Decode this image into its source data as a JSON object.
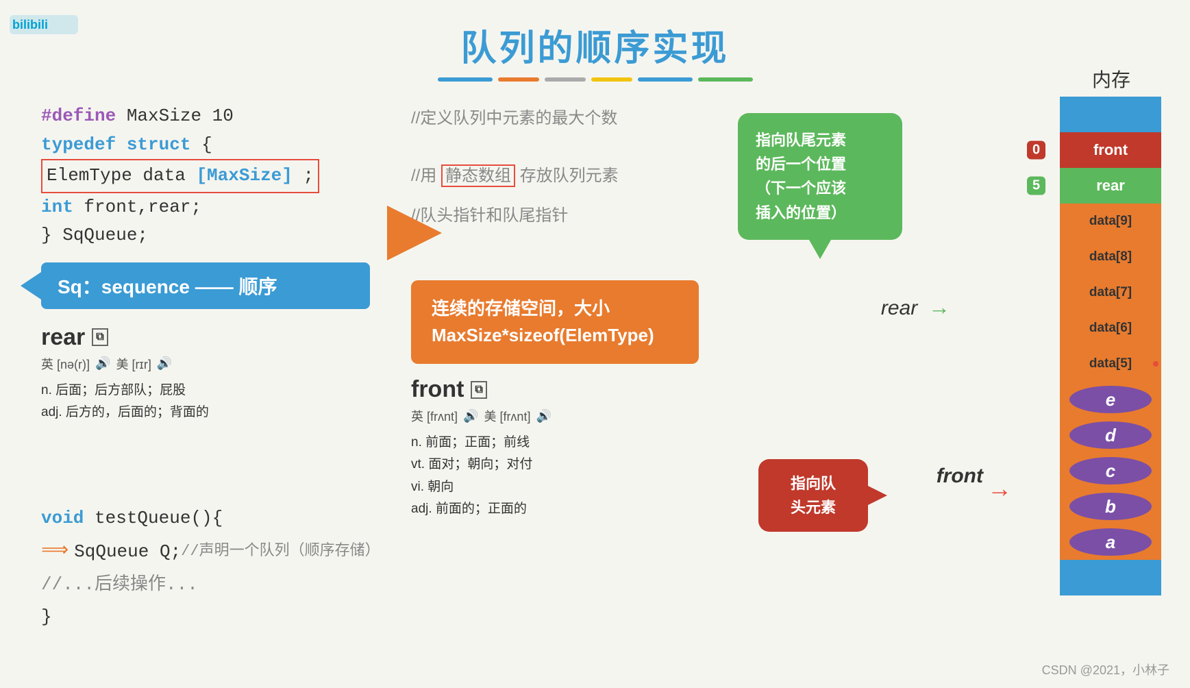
{
  "title": "队列的顺序实现",
  "memory_label": "内存",
  "color_bars": [
    "#3b9bd4",
    "#e87b2e",
    "#aaa",
    "#f1c40f",
    "#3b9bd4",
    "#5cb85c"
  ],
  "color_bar_widths": [
    80,
    60,
    60,
    60,
    80,
    80
  ],
  "code": {
    "line1": "#define MaxSize 10",
    "line1_comment": "//定义队列中元素的最大个数",
    "line2": "typedef struct{",
    "line3_pre": "ElemType data",
    "line3_mid": "[MaxSize]",
    "line3_suf": ";",
    "line3_comment": "//用静态数组存放队列元素",
    "line4": "    int front,rear;",
    "line4_comment": "//队头指针和队尾指针",
    "line5": "} SqQueue;",
    "banner": "Sq：sequence —— 顺序"
  },
  "dict_rear": {
    "word": "rear",
    "phonetic_uk": "英 [nə(r)]",
    "phonetic_us": "美 [rɪr]",
    "def1": "n. 后面；后方部队；屁股",
    "def2": "adj. 后方的，后面的；背面的"
  },
  "dict_front": {
    "word": "front",
    "phonetic_uk": "英 [frʌnt]",
    "phonetic_us": "美 [frʌnt]",
    "def1": "n. 前面；正面；前线",
    "def2": "vt. 面对；朝向；对付",
    "def3": "vi. 朝向",
    "def4": "adj. 前面的；正面的"
  },
  "orange_box": {
    "text": "连续的存储空间，大小\nMaxSize*sizeof(ElemType)"
  },
  "green_bubble": {
    "text": "指向队尾元素\n的后一个位置\n（下一个应该\n插入的位置）"
  },
  "red_bubble": {
    "text": "指向队\n头元素"
  },
  "rear_label": "rear",
  "front_mem_label": "front",
  "memory": {
    "cells": [
      {
        "label": "",
        "type": "blue-bg",
        "text": ""
      },
      {
        "label": "front_label",
        "type": "red-cell",
        "text": "front"
      },
      {
        "label": "rear_label",
        "type": "green-cell",
        "text": "rear"
      },
      {
        "label": "",
        "type": "orange-bg",
        "text": "data[9]"
      },
      {
        "label": "",
        "type": "orange-bg",
        "text": "data[8]"
      },
      {
        "label": "",
        "type": "orange-bg",
        "text": "data[7]"
      },
      {
        "label": "",
        "type": "orange-bg",
        "text": "data[6]"
      },
      {
        "label": "rear_arrow",
        "type": "orange-bg",
        "text": "data[5]"
      },
      {
        "label": "",
        "type": "oval",
        "text": "e"
      },
      {
        "label": "",
        "type": "oval",
        "text": "d"
      },
      {
        "label": "",
        "type": "oval",
        "text": "c"
      },
      {
        "label": "",
        "type": "oval",
        "text": "b"
      },
      {
        "label": "front_arrow",
        "type": "oval",
        "text": "a"
      },
      {
        "label": "",
        "type": "blue-bg",
        "text": ""
      }
    ],
    "index0": "0",
    "index5": "5"
  },
  "bottom_code": {
    "line1": "void testQueue(){",
    "line2_arrow": "⟹",
    "line2": "SqQueue Q;",
    "line2_comment": "//声明一个队列（顺序存储）",
    "line3": "    //...后续操作...",
    "line4": "}"
  },
  "watermark": "CSDN @2021，小林子"
}
